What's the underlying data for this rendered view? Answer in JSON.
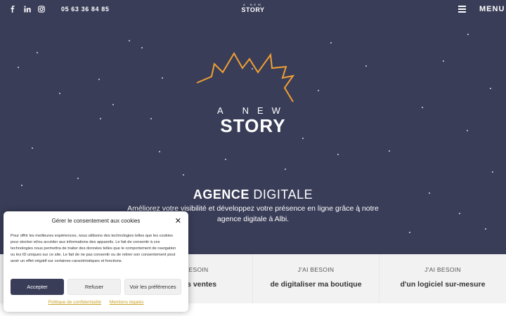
{
  "topbar": {
    "social": [
      "facebook-icon",
      "linkedin-icon",
      "instagram-icon"
    ],
    "phone": "05 63 36 84 85",
    "logo_top": "A NEW",
    "logo_bottom": "STORY",
    "menu_label": "MENU"
  },
  "hero": {
    "logo_top": "A NEW",
    "logo_bottom": "STORY",
    "title_bold": "AGENCE",
    "title_light": "DIGITALE",
    "subtitle": "Améliorez votre visibilité et développez votre présence en ligne grâce à notre agence digitale à Albi."
  },
  "cards": [
    {
      "need": "BESOIN",
      "what": "mes ventes"
    },
    {
      "need": "J'AI BESOIN",
      "what": "de digitaliser ma boutique"
    },
    {
      "need": "J'AI BESOIN",
      "what": "d'un logiciel sur-mesure"
    }
  ],
  "cookie": {
    "title": "Gérer le consentement aux cookies",
    "text": "Pour offrir les meilleures expériences, nous utilisons des technologies telles que les cookies pour stocker et/ou accéder aux informations des appareils. Le fait de consentir à ces technologies nous permettra de traiter des données telles que le comportement de navigation ou les ID uniques sur ce site. Le fait de ne pas consentir ou de retirer son consentement peut avoir un effet négatif sur certaines caractéristiques et fonctions.",
    "accept": "Accepter",
    "refuse": "Refuser",
    "preferences": "Voir les préférences",
    "privacy_link": "Politique de confidentialité",
    "legal_link": "Mentions légales"
  },
  "colors": {
    "background": "#393d58",
    "accent": "#f0a033",
    "button": "#393d58",
    "link": "#c9a227"
  }
}
